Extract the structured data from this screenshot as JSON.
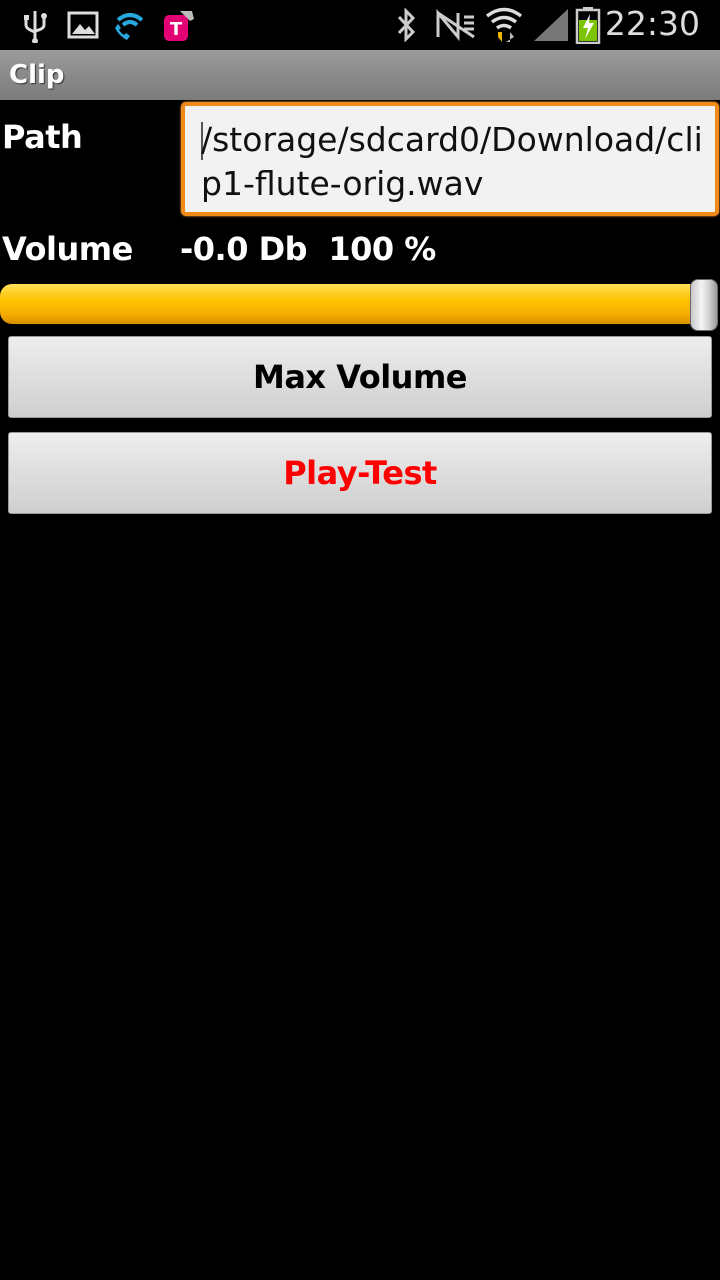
{
  "status_bar": {
    "time": "22:30",
    "icons": [
      "usb-icon",
      "gallery-icon",
      "wifi-call-icon",
      "t-mobile-icon",
      "bluetooth-icon",
      "no-signal-icon",
      "wifi-icon",
      "signal-icon",
      "battery-charging-icon"
    ]
  },
  "app": {
    "title": "Clip"
  },
  "path": {
    "label": "Path",
    "value": "/storage/sdcard0/Download/clip1-flute-orig.wav"
  },
  "volume": {
    "label": "Volume",
    "db_text": "-0.0 Db",
    "percent_text": "100 %",
    "level_percent": 100
  },
  "buttons": {
    "max_volume": "Max Volume",
    "play_test": "Play-Test"
  },
  "colors": {
    "accent_orange": "#f28a1a",
    "slider_yellow": "#ffc400",
    "play_test_red": "#ff0000"
  }
}
